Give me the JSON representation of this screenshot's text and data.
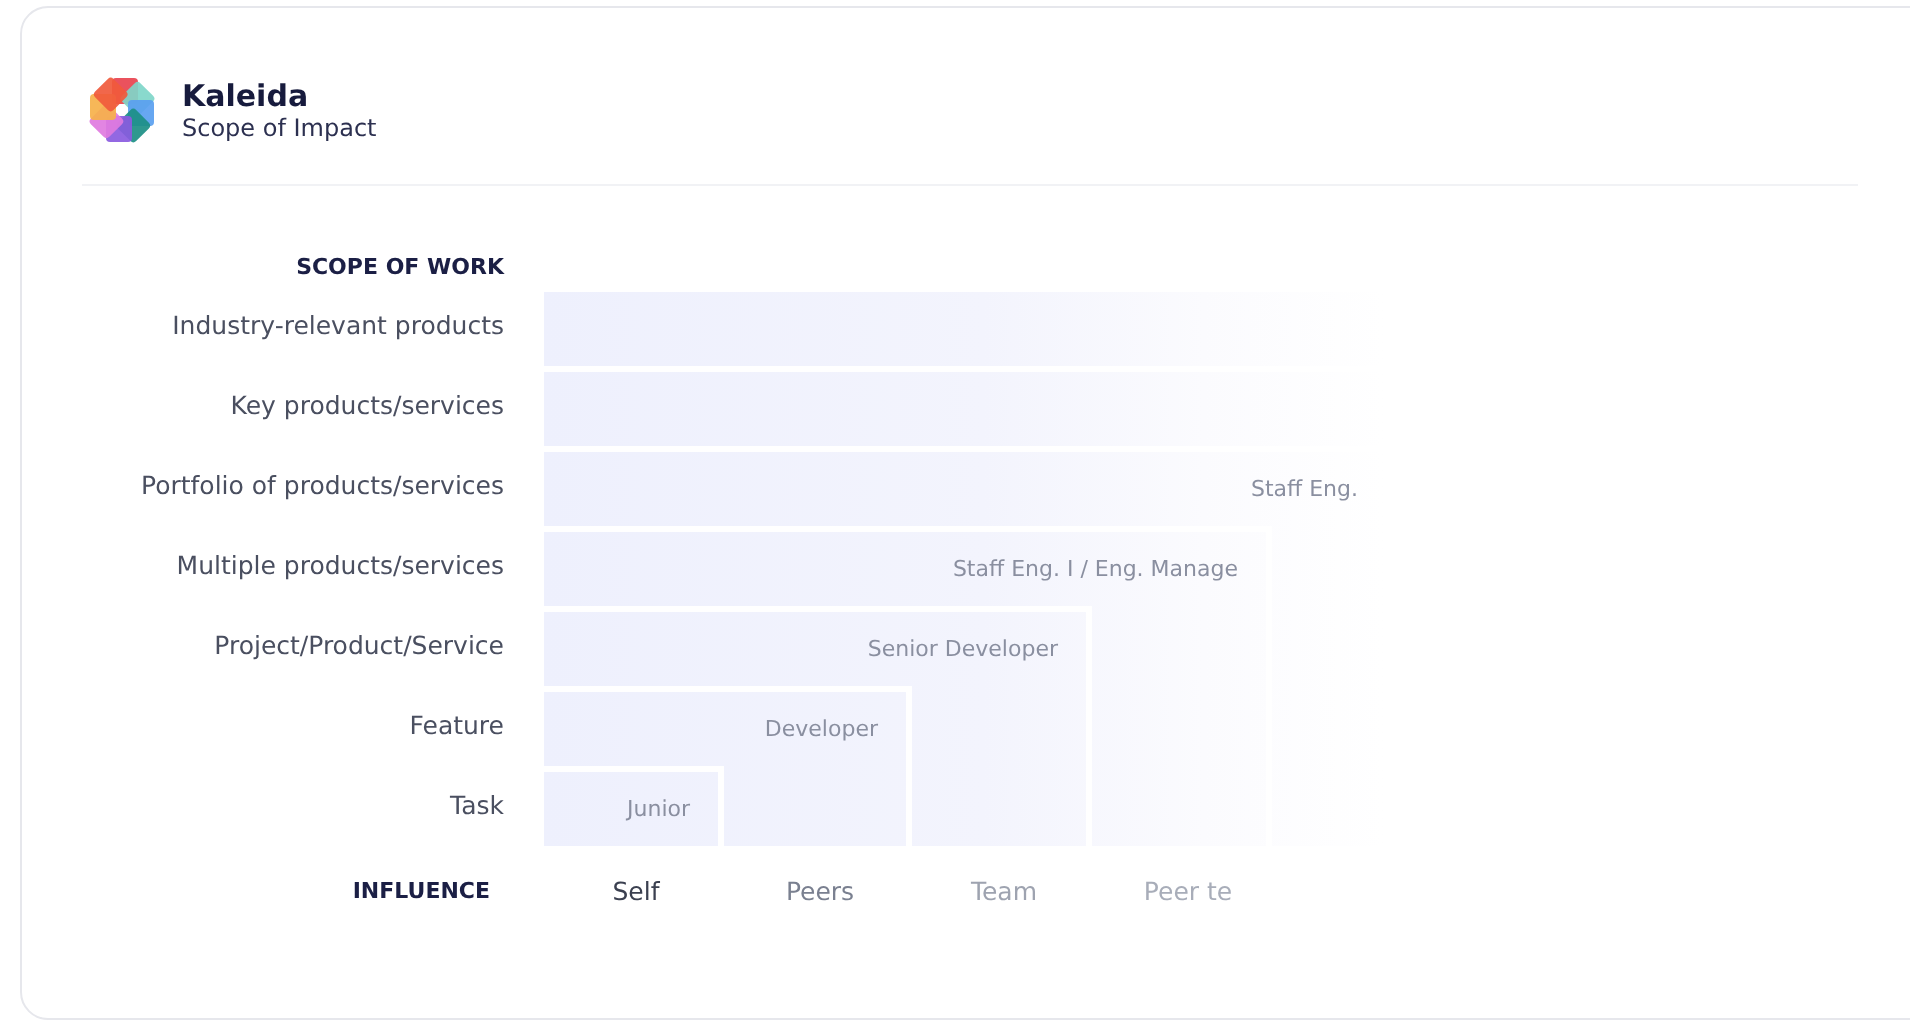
{
  "brand": {
    "name": "Kaleida",
    "subtitle": "Scope of Impact"
  },
  "scope_of_work": {
    "heading": "SCOPE OF WORK",
    "rows": [
      {
        "label": "Industry-relevant products"
      },
      {
        "label": "Key products/services"
      },
      {
        "label": "Portfolio of products/services",
        "role": "Staff Eng."
      },
      {
        "label": "Multiple products/services",
        "role": "Staff Eng. I / Eng. Manage"
      },
      {
        "label": "Project/Product/Service",
        "role": "Senior Developer"
      },
      {
        "label": "Feature",
        "role": "Developer"
      },
      {
        "label": "Task",
        "role": "Junior"
      }
    ]
  },
  "influence": {
    "heading": "INFLUENCE",
    "columns": [
      "Self",
      "Peers",
      "Team",
      "Peer te"
    ]
  }
}
